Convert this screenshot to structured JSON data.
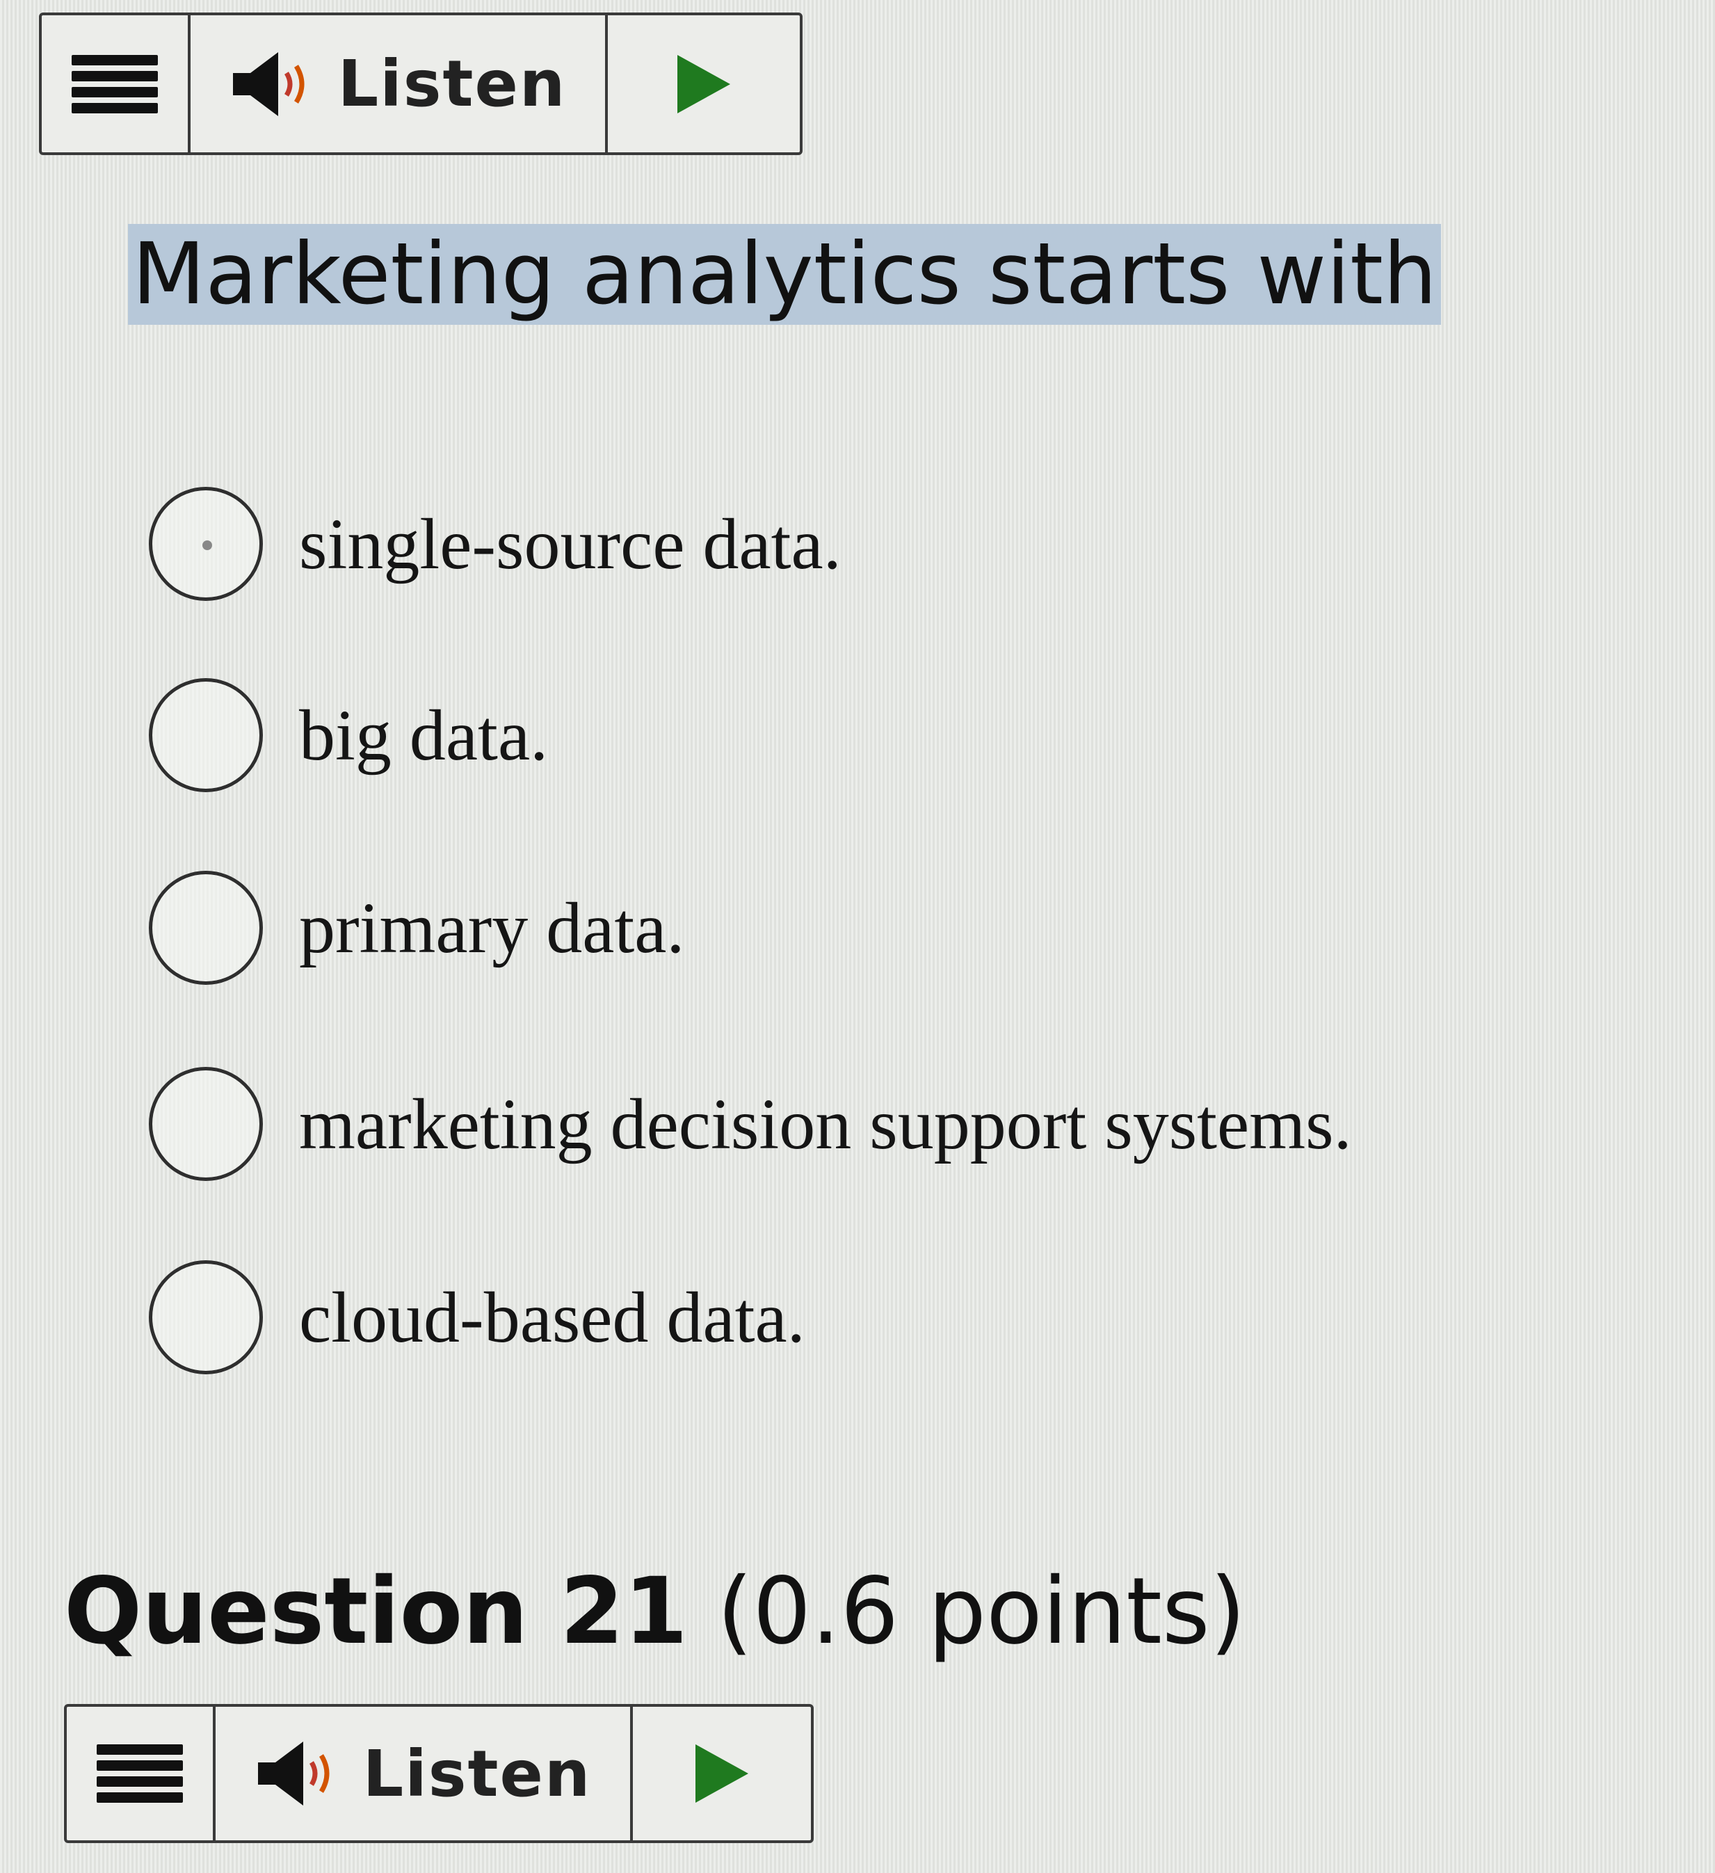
{
  "listen_toolbar_top": {
    "menu_icon": "hamburger-menu-icon",
    "speaker_icon": "speaker-icon",
    "listen_label": "Listen",
    "play_icon": "play-icon",
    "play_color": "#1f7a1f"
  },
  "question_prompt": "Marketing analytics starts with",
  "options": [
    {
      "label": "single-source data.",
      "selected": false
    },
    {
      "label": "big data.",
      "selected": false
    },
    {
      "label": "primary data.",
      "selected": false
    },
    {
      "label": "marketing decision support systems.",
      "selected": false
    },
    {
      "label": "cloud-based data.",
      "selected": false
    }
  ],
  "next_question": {
    "title": "Question 21",
    "points": "(0.6 points)"
  },
  "listen_toolbar_bottom": {
    "menu_icon": "hamburger-menu-icon",
    "speaker_icon": "speaker-icon",
    "listen_label": "Listen",
    "play_icon": "play-icon"
  },
  "colors": {
    "highlight": "#b7c8d9",
    "background": "#e6e8e4"
  }
}
